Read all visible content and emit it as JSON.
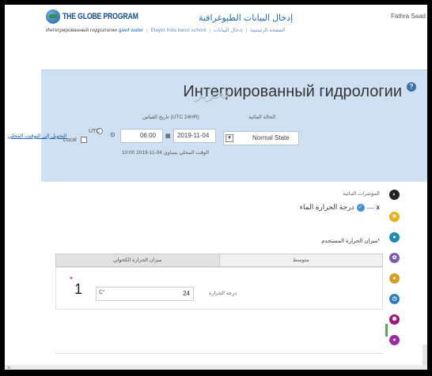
{
  "header": {
    "logo_text": "THE GLOBE PROGRAM",
    "data_entry_title": "إدخال البيانات الطبوغرافية",
    "user_name": "Fathra Saad"
  },
  "breadcrumb": {
    "items": [
      "الصفحة الرئيسية",
      "إدخال البيانات",
      "Elayet Inda basic school"
    ],
    "active": "gawf water",
    "current": "Интегрированный гидрологии"
  },
  "panel": {
    "title": "Интегрированный гидрологии",
    "edit_label": "تحرير",
    "water_state_label": "الحالة المائية",
    "water_state_value": "Normal State",
    "date_label": "تاريخ القياس (UTC 24HR)",
    "date_value": "2019-11-04",
    "time_value": "06:00",
    "utc_label": "UTC",
    "local_label": "Local",
    "local_link": "التحويل إلى التوقيت المحلي",
    "hint_text": "الوقت المحلي يساوي 04-11-2019 10:00"
  },
  "section": {
    "heading": "المؤشرات المائية",
    "lang_x": "x",
    "lang_text": "درجة الحرارة الماء",
    "required_label": "ميزان الحرارة المستخدم",
    "tabs": [
      "متوسط",
      "ميزان الحرارة الكحولي"
    ],
    "row_number": "1",
    "temp_label": "درجة الحرارة",
    "temp_unit": "C°",
    "temp_value": "24"
  },
  "icons": [
    "contrast-icon",
    "sun-icon",
    "water-drop-icon",
    "flower-icon",
    "lightbulb-icon",
    "clock-icon",
    "atom-icon",
    "pin-icon"
  ]
}
